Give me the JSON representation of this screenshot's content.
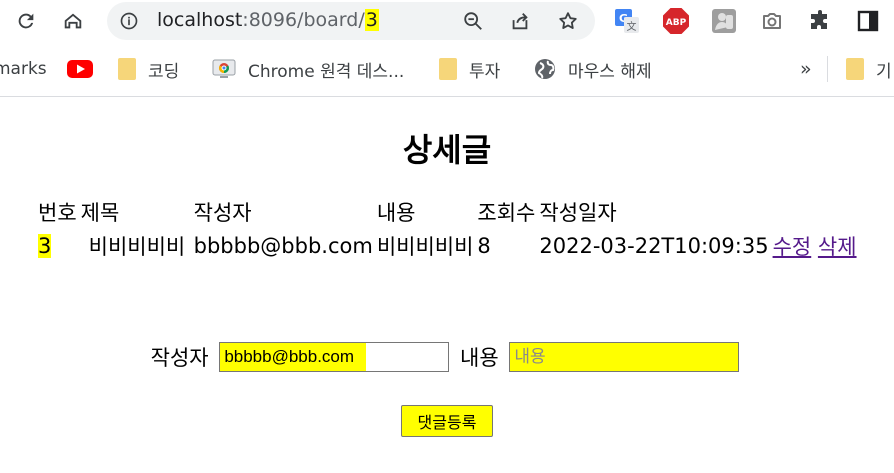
{
  "browser": {
    "url": {
      "host": "localhost",
      "path_prefix": ":8096/board/",
      "path_highlight": "3"
    },
    "icons": {
      "reload": "reload-icon",
      "home": "home-icon",
      "info": "info-icon",
      "zoom_out": "zoom-out-icon",
      "share": "share-icon",
      "bookmark_star": "star-icon",
      "translate": "google-translate-icon",
      "adblock": "abp-icon",
      "extension_person": "person-extension-icon",
      "camera": "camera-icon",
      "extensions": "puzzle-icon",
      "side_panel": "side-panel-icon"
    },
    "adblock_label": "ABP",
    "bookmarks": [
      {
        "label": "marks",
        "icon": "none"
      },
      {
        "label": "",
        "icon": "youtube-icon"
      },
      {
        "label": "코딩",
        "icon": "folder-icon"
      },
      {
        "label": "Chrome 원격 데스...",
        "icon": "chrome-remote-desktop-icon"
      },
      {
        "label": "투자",
        "icon": "folder-icon"
      },
      {
        "label": "마우스 해제",
        "icon": "globe-icon"
      }
    ],
    "bookmarks_overflow": "»",
    "bookmarks_trailing": "기"
  },
  "page": {
    "title": "상세글",
    "table": {
      "headers": [
        "번호",
        "제목",
        "작성자",
        "내용",
        "조회수",
        "작성일자"
      ],
      "row": {
        "id": "3",
        "title": "비비비비비",
        "writer": "bbbbb@bbb.com",
        "content": "비비비비비",
        "views": "8",
        "created": "2022-03-22T10:09:35",
        "edit_link": "수정",
        "delete_link": "삭제"
      }
    },
    "comment_form": {
      "writer_label": "작성자",
      "writer_value": "bbbbb@bbb.com",
      "content_label": "내용",
      "content_placeholder": "내용",
      "submit_label": "댓글등록"
    }
  },
  "colors": {
    "highlight": "#ffff00",
    "link": "#551a8b",
    "omnibox_bg": "#f1f3f4",
    "folder": "#f6d67a",
    "youtube_red": "#ff0000",
    "abp_red": "#d6262b"
  }
}
